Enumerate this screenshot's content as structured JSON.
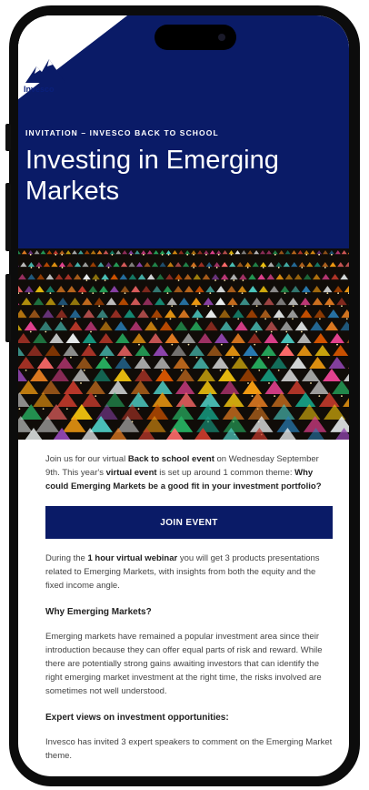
{
  "brand": {
    "logo_text": "Invesco",
    "navy": "#0a1b67"
  },
  "hero": {
    "eyebrow": "INVITATION – INVESCO BACK TO SCHOOL",
    "title_line1": "Investing in Emerging",
    "title_line2": "Markets"
  },
  "image": {
    "description_icon": "market-photo"
  },
  "intro": {
    "t1": "Join us for our virtual ",
    "b1": "Back to school event",
    "t2": " on Wednesday September 9th. This year's ",
    "b2": "virtual event",
    "t3": " is set up around 1 common theme: ",
    "b3": "Why could Emerging Markets be a good fit in your investment portfolio?"
  },
  "cta": {
    "label": "JOIN EVENT"
  },
  "webinar": {
    "t1": "During the ",
    "b1": "1 hour virtual webinar",
    "t2": " you will get 3 products presentations related to Emerging Markets, with insights from both the equity and the fixed income angle."
  },
  "section1": {
    "heading": "Why Emerging Markets?",
    "text": "Emerging markets have remained a popular investment area since their introduction because they can offer equal parts of risk and reward. While there are potentially strong gains awaiting investors that can identify the right emerging market investment at the right time, the risks involved are sometimes not well understood."
  },
  "section2": {
    "heading": "Expert views on investment opportunities:",
    "text": "Invesco has invited 3 expert speakers to comment on the Emerging Market theme."
  }
}
